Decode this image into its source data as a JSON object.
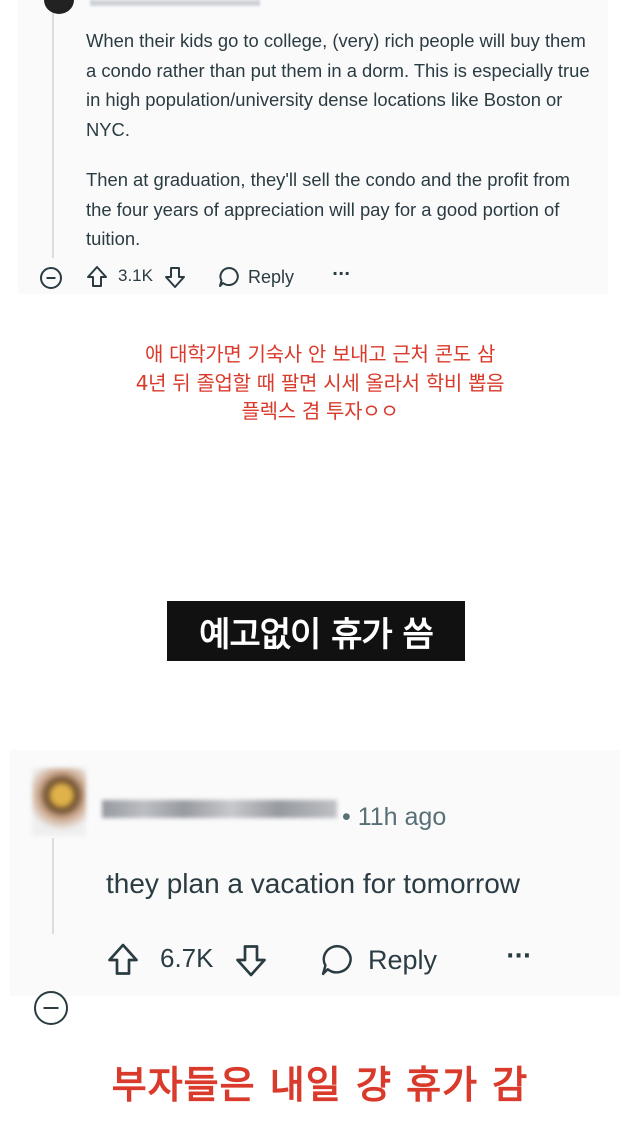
{
  "comment1": {
    "paragraphs": [
      "When their kids go to college, (very) rich people will buy them a condo rather than put them in a dorm. This is especially true in high population/university dense locations like Boston or NYC.",
      "Then at graduation, they'll sell the condo and the profit from the four years of appreciation will pay for a good portion of tuition."
    ],
    "upvotes": "3.1K",
    "reply_label": "Reply",
    "more_label": "···"
  },
  "caption1": {
    "lines": [
      "애 대학가면 기숙사 안 보내고 근처 콘도 삼",
      "4년 뒤 졸업할 때 팔면 시세 올라서 학비 뽑음",
      "플렉스 겸 투자ㅇㅇ"
    ]
  },
  "label": "예고없이 휴가 씀",
  "comment2": {
    "separator": "•",
    "time": "11h ago",
    "body": "they plan a vacation for tomorrow",
    "upvotes": "6.7K",
    "reply_label": "Reply",
    "more_label": "···"
  },
  "caption2": "부자들은 내일 걍 휴가 감",
  "colors": {
    "caption_red": "#d93a2b",
    "text_dark": "#2a3c42",
    "meta_gray": "#576f76",
    "card_bg": "#fafafb",
    "label_bg": "#111111"
  },
  "icons": [
    "collapse-icon",
    "upvote-icon",
    "downvote-icon",
    "reply-bubble-icon",
    "more-icon"
  ]
}
